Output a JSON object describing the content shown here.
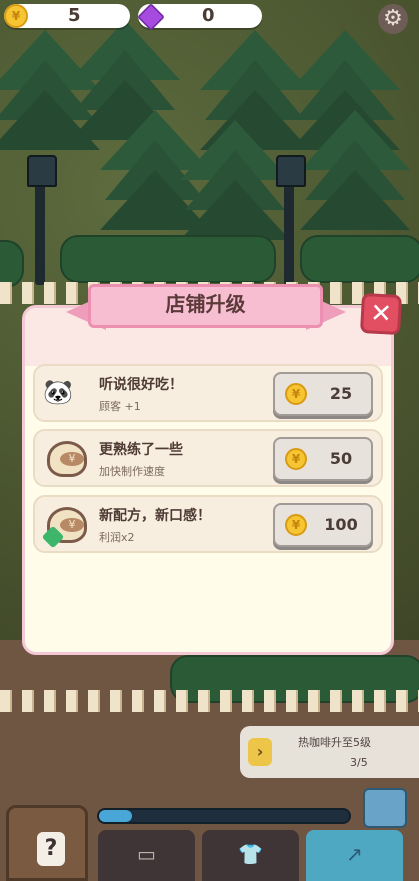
{
  "hud": {
    "coins": "5",
    "gems": "0",
    "coin_icon": "coin-icon",
    "gem_icon": "gem-icon",
    "settings_icon": "gear-icon"
  },
  "modal": {
    "title": "店铺升级",
    "close_icon": "close-icon",
    "upgrades": [
      {
        "icon": "pets-icon",
        "title": "听说很好吃！",
        "desc": "顾客 +1",
        "price": "25"
      },
      {
        "icon": "coffee-cup-icon",
        "title": "更熟练了一些",
        "desc": "加快制作速度",
        "price": "50"
      },
      {
        "icon": "coffee-cup-tag-icon",
        "title": "新配方，新口感！",
        "desc": "利润x2",
        "price": "100"
      }
    ]
  },
  "quest": {
    "title": "热咖啡升至5级",
    "progress": "3/5"
  },
  "progress_bar": {
    "fill": 0.13
  },
  "colors": {
    "accent_pink": "#f7bed2",
    "close_red": "#e24e62",
    "coin_gold": "#f7c531",
    "gem_purple": "#a64ae0"
  }
}
